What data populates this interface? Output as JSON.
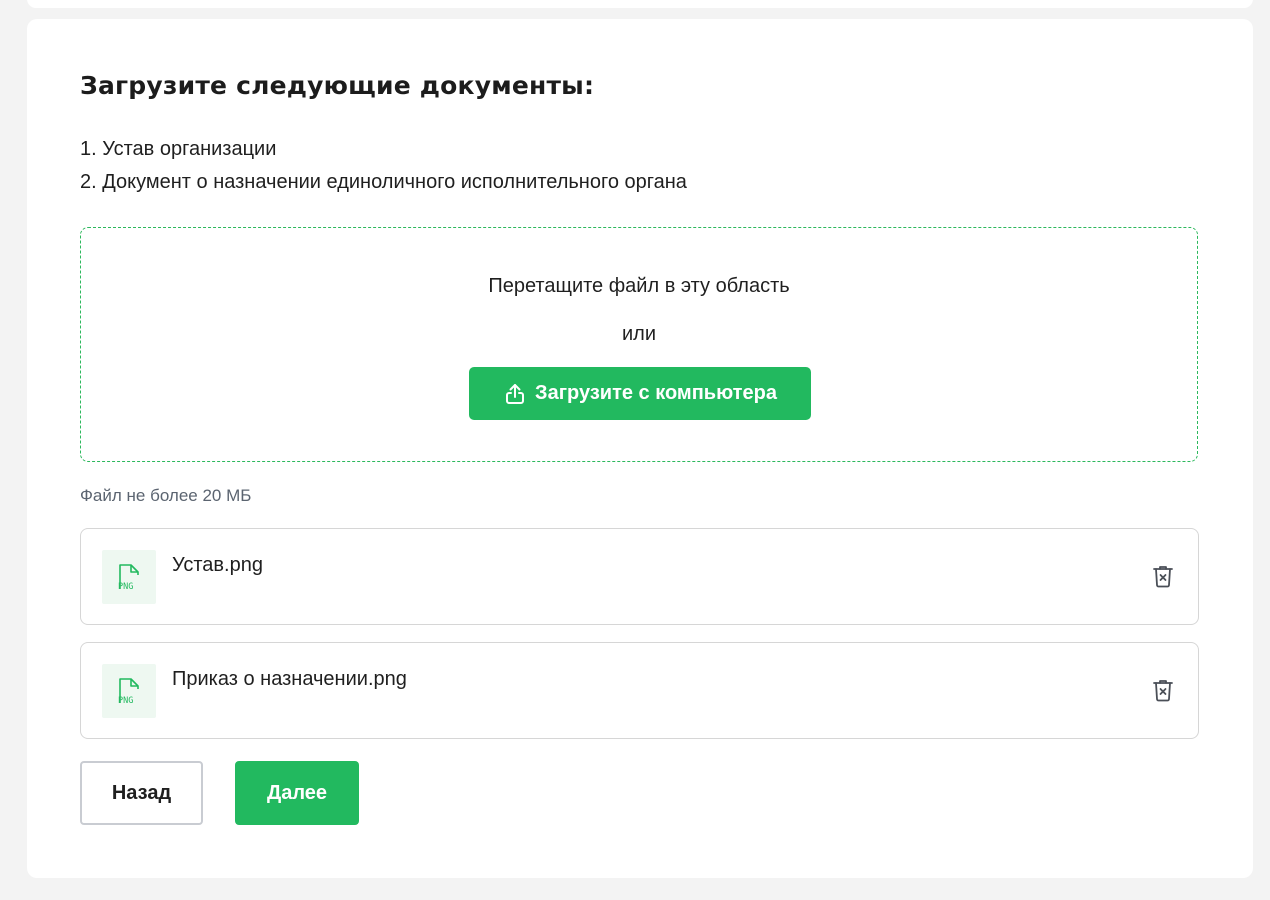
{
  "heading": "Загрузите следующие документы:",
  "documents": [
    "1. Устав организации",
    "2. Документ о назначении единоличного исполнительного органа"
  ],
  "dropzone": {
    "hint": "Перетащите файл в эту область",
    "or": "или",
    "upload_label": "Загрузите с компьютера"
  },
  "size_note": "Файл не более 20 МБ",
  "files": [
    {
      "name": "Устав.png",
      "type_label": "PNG"
    },
    {
      "name": "Приказ о назначении.png",
      "type_label": "PNG"
    }
  ],
  "actions": {
    "back_label": "Назад",
    "next_label": "Далее"
  },
  "colors": {
    "accent": "#22b95f",
    "dropzone_border": "#2cb85c",
    "file_thumb_bg": "#eef8f1",
    "muted_text": "#5b6470"
  },
  "icons": {
    "upload": "upload-icon",
    "file": "png-file-icon",
    "delete": "trash-icon"
  }
}
